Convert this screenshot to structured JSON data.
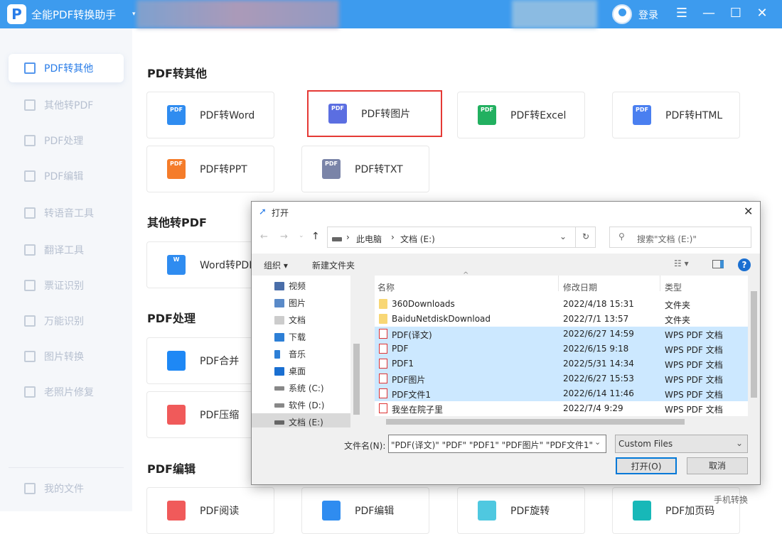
{
  "app": {
    "logo": "P",
    "title": "全能PDF转换助手",
    "login": "登录",
    "window_controls": [
      "☰",
      "—",
      "☐",
      "✕"
    ]
  },
  "sidebar": {
    "items": [
      "PDF转其他",
      "其他转PDF",
      "PDF处理",
      "PDF编辑",
      "转语音工具",
      "翻译工具",
      "票证识别",
      "万能识别",
      "图片转换",
      "老照片修复"
    ],
    "footer": "我的文件"
  },
  "sections": {
    "pdf_to_other": {
      "title": "PDF转其他",
      "cards": [
        "PDF转Word",
        "PDF转图片",
        "PDF转Excel",
        "PDF转HTML",
        "PDF转PPT",
        "PDF转TXT"
      ]
    },
    "other_to_pdf": {
      "title": "其他转PDF",
      "cards": [
        "Word转PDF"
      ]
    },
    "pdf_process": {
      "title": "PDF处理",
      "cards": [
        "PDF合并",
        "PDF压缩"
      ]
    },
    "pdf_edit": {
      "title": "PDF编辑",
      "cards": [
        "PDF阅读",
        "PDF编辑",
        "PDF旋转",
        "PDF加页码"
      ]
    }
  },
  "mobile_convert": "手机转换",
  "dialog": {
    "title": "打开",
    "breadcrumb": [
      "此电脑",
      "文档 (E:)"
    ],
    "search_placeholder": "搜索\"文档 (E:)\"",
    "toolbar": {
      "organize": "组织 ▾",
      "new_folder": "新建文件夹"
    },
    "tree": [
      "视频",
      "图片",
      "文档",
      "下载",
      "音乐",
      "桌面",
      "系统 (C:)",
      "软件 (D:)",
      "文档 (E:)"
    ],
    "columns": [
      "名称",
      "修改日期",
      "类型"
    ],
    "files": [
      {
        "name": "360Downloads",
        "date": "2022/4/18 15:31",
        "type": "文件夹",
        "kind": "folder",
        "selected": false
      },
      {
        "name": "BaiduNetdiskDownload",
        "date": "2022/7/1 13:57",
        "type": "文件夹",
        "kind": "folder",
        "selected": false
      },
      {
        "name": "PDF(译文)",
        "date": "2022/6/27 14:59",
        "type": "WPS PDF 文档",
        "kind": "pdf",
        "selected": true
      },
      {
        "name": "PDF",
        "date": "2022/6/15 9:18",
        "type": "WPS PDF 文档",
        "kind": "pdf",
        "selected": true
      },
      {
        "name": "PDF1",
        "date": "2022/5/31 14:34",
        "type": "WPS PDF 文档",
        "kind": "pdf",
        "selected": true
      },
      {
        "name": "PDF图片",
        "date": "2022/6/27 15:53",
        "type": "WPS PDF 文档",
        "kind": "pdf",
        "selected": true
      },
      {
        "name": "PDF文件1",
        "date": "2022/6/14 11:46",
        "type": "WPS PDF 文档",
        "kind": "pdf",
        "selected": true
      },
      {
        "name": "我坐在院子里",
        "date": "2022/7/4 9:29",
        "type": "WPS PDF 文档",
        "kind": "pdf",
        "selected": false
      }
    ],
    "filename_label": "文件名(N):",
    "filename_value": "\"PDF(译文)\" \"PDF\" \"PDF1\" \"PDF图片\" \"PDF文件1\"",
    "filter": "Custom Files",
    "open": "打开(O)",
    "cancel": "取消"
  }
}
